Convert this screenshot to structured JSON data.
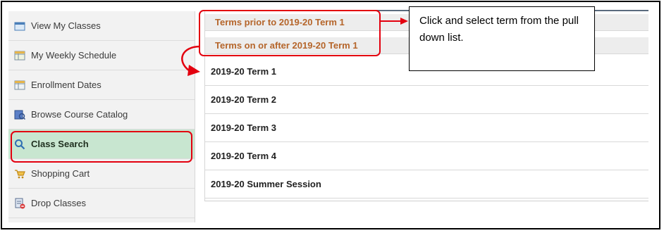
{
  "sidebar": {
    "items": [
      {
        "label": "View My Classes",
        "icon": "calendar-icon"
      },
      {
        "label": "My Weekly Schedule",
        "icon": "weekly-schedule-icon"
      },
      {
        "label": "Enrollment Dates",
        "icon": "enrollment-dates-icon"
      },
      {
        "label": "Browse Course Catalog",
        "icon": "catalog-icon"
      },
      {
        "label": "Class Search",
        "icon": "search-icon",
        "active": true
      },
      {
        "label": "Shopping Cart",
        "icon": "shopping-cart-icon"
      },
      {
        "label": "Drop Classes",
        "icon": "drop-classes-icon"
      }
    ]
  },
  "term_menu": {
    "headers": [
      "Terms prior to 2019-20 Term 1",
      "Terms on or after 2019-20 Term 1"
    ],
    "terms": [
      "2019-20 Term 1",
      "2019-20 Term 2",
      "2019-20 Term 3",
      "2019-20 Term 4",
      "2019-20 Summer Session"
    ]
  },
  "callout": {
    "text": "Click and select term from the pull down list."
  },
  "colors": {
    "annotation_red": "#e3000f",
    "header_text": "#b5652a",
    "active_item_bg": "#c8e6d0"
  }
}
